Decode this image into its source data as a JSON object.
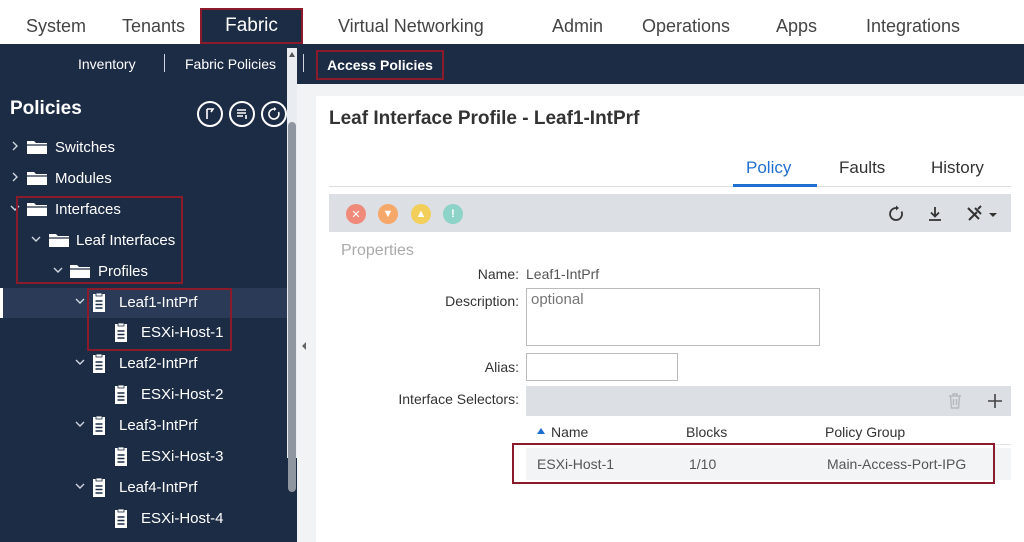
{
  "topnav": {
    "tabs": [
      "System",
      "Tenants",
      "Fabric",
      "Virtual Networking",
      "Admin",
      "Operations",
      "Apps",
      "Integrations"
    ],
    "active": "Fabric"
  },
  "subnav": {
    "items": [
      "Inventory",
      "Fabric Policies",
      "Access Policies"
    ],
    "active": "Access Policies"
  },
  "sidebar": {
    "title": "Policies",
    "tools": [
      "pin-icon",
      "list-icon",
      "refresh-icon"
    ],
    "tree": [
      {
        "label": "Switches",
        "level": 0,
        "icon": "folder-icon",
        "expanded": false
      },
      {
        "label": "Modules",
        "level": 0,
        "icon": "folder-icon",
        "expanded": false
      },
      {
        "label": "Interfaces",
        "level": 0,
        "icon": "folder-icon",
        "expanded": true
      },
      {
        "label": "Leaf Interfaces",
        "level": 1,
        "icon": "folder-icon",
        "expanded": true
      },
      {
        "label": "Profiles",
        "level": 2,
        "icon": "folder-icon",
        "expanded": true
      },
      {
        "label": "Leaf1-IntPrf",
        "level": 3,
        "icon": "document-icon",
        "expanded": true,
        "selected": true
      },
      {
        "label": "ESXi-Host-1",
        "level": 4,
        "icon": "document-icon"
      },
      {
        "label": "Leaf2-IntPrf",
        "level": 3,
        "icon": "document-icon",
        "expanded": true
      },
      {
        "label": "ESXi-Host-2",
        "level": 4,
        "icon": "document-icon"
      },
      {
        "label": "Leaf3-IntPrf",
        "level": 3,
        "icon": "document-icon",
        "expanded": true
      },
      {
        "label": "ESXi-Host-3",
        "level": 4,
        "icon": "document-icon"
      },
      {
        "label": "Leaf4-IntPrf",
        "level": 3,
        "icon": "document-icon",
        "expanded": true
      },
      {
        "label": "ESXi-Host-4",
        "level": 4,
        "icon": "document-icon"
      }
    ]
  },
  "main": {
    "title": "Leaf Interface Profile - Leaf1-IntPrf",
    "tabs": [
      "Policy",
      "Faults",
      "History"
    ],
    "active_tab": "Policy",
    "section": "Properties",
    "fields": {
      "name_label": "Name:",
      "name_value": "Leaf1-IntPrf",
      "description_label": "Description:",
      "description_placeholder": "optional",
      "alias_label": "Alias:",
      "alias_value": "",
      "selectors_label": "Interface Selectors:"
    },
    "selectors_table": {
      "columns": [
        "Name",
        "Blocks",
        "Policy Group"
      ],
      "rows": [
        [
          "ESXi-Host-1",
          "1/10",
          "Main-Access-Port-IPG"
        ]
      ]
    }
  },
  "colors": {
    "nav_dark": "#1c2c45",
    "highlight": "#8b1a2b",
    "accent": "#1f6fd1",
    "fault_critical": "#f08a7a",
    "fault_major": "#f5a86a",
    "fault_minor": "#f2cf5a",
    "fault_warning": "#8dd3c7"
  }
}
